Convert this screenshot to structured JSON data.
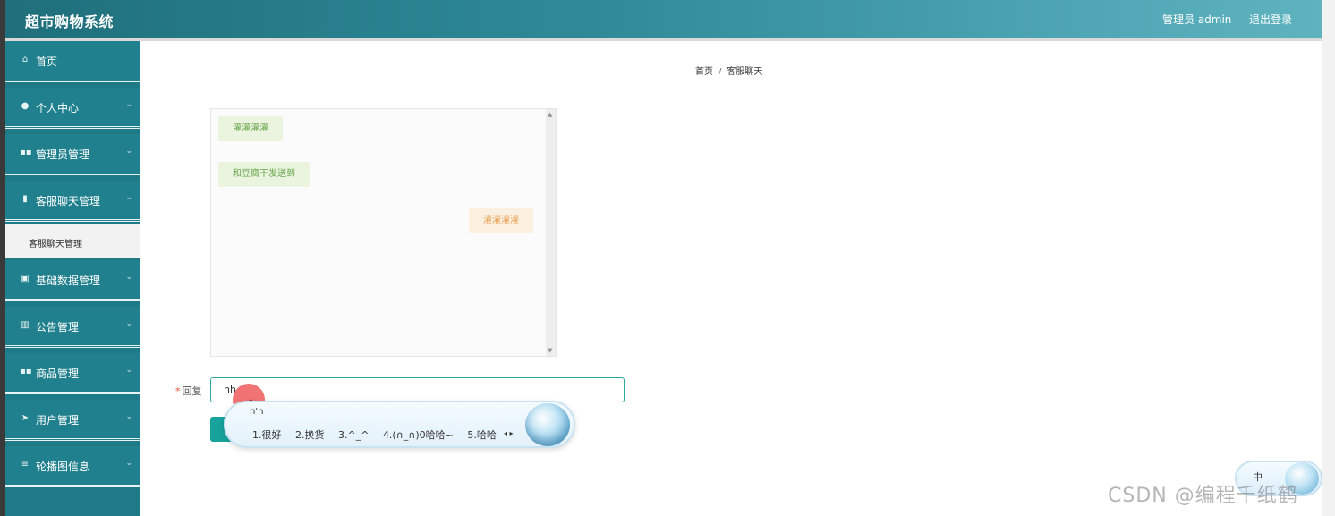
{
  "header": {
    "title": "超市购物系统",
    "user": "管理员 admin",
    "logout": "退出登录"
  },
  "sidebar": {
    "items": [
      {
        "label": "首页",
        "icon": "home-icon",
        "expandable": false
      },
      {
        "label": "个人中心",
        "icon": "user-icon",
        "expandable": true
      },
      {
        "label": "管理员管理",
        "icon": "grid-icon",
        "expandable": true
      },
      {
        "label": "客服聊天管理",
        "icon": "clipboard-icon",
        "expandable": true
      },
      {
        "label": "基础数据管理",
        "icon": "chart-icon",
        "expandable": true
      },
      {
        "label": "公告管理",
        "icon": "bars-icon",
        "expandable": true
      },
      {
        "label": "商品管理",
        "icon": "grid-icon",
        "expandable": true
      },
      {
        "label": "用户管理",
        "icon": "send-icon",
        "expandable": true
      },
      {
        "label": "轮播图信息",
        "icon": "sliders-icon",
        "expandable": true
      }
    ],
    "submenu": {
      "label": "客服聊天管理"
    }
  },
  "breadcrumb": {
    "home": "首页",
    "separator": "/",
    "current": "客服聊天"
  },
  "chat": {
    "messages": [
      {
        "side": "left",
        "text": "灌灌灌灌"
      },
      {
        "side": "left",
        "text": "和豆腐干发送到"
      },
      {
        "side": "right",
        "text": "灌灌灌灌"
      }
    ]
  },
  "reply": {
    "label": "回复",
    "required_mark": "*",
    "value": "hh"
  },
  "ime": {
    "pinyin": "h'h",
    "candidates": [
      "1.很好",
      "2.换货",
      "3.^_^",
      "4.(∩_∩)0哈哈~",
      "5.哈哈"
    ],
    "mode": "中"
  },
  "watermark": "CSDN @编程千纸鹤",
  "colors": {
    "header_start": "#1f6f7c",
    "sidebar": "#21808d",
    "left_bubble": "#eaf4df",
    "right_bubble": "#fcf0e1",
    "accent": "#17a39c"
  }
}
